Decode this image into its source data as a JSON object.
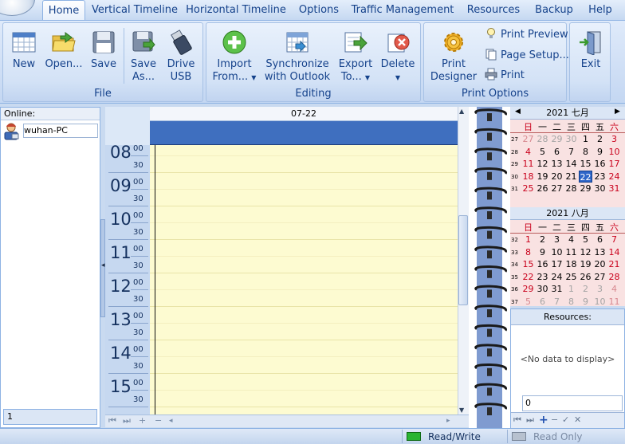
{
  "ribbon": {
    "tabs": [
      {
        "label": "Home",
        "active": true
      },
      {
        "label": "Vertical Timeline"
      },
      {
        "label": "Horizontal Timeline"
      },
      {
        "label": "Options"
      },
      {
        "label": "Traffic Management"
      },
      {
        "label": "Resources"
      },
      {
        "label": "Backup"
      },
      {
        "label": "Help"
      }
    ],
    "groups": {
      "file": {
        "label": "File",
        "buttons": {
          "new": "New",
          "open": "Open...",
          "save": "Save",
          "save_as_1": "Save",
          "save_as_2": "As...",
          "drive_usb_1": "Drive",
          "drive_usb_2": "USB"
        }
      },
      "editing": {
        "label": "Editing",
        "buttons": {
          "import_1": "Import",
          "import_2": "From...",
          "sync_1": "Synchronize",
          "sync_2": "with Outlook",
          "export_1": "Export",
          "export_2": "To...",
          "delete": "Delete"
        }
      },
      "print": {
        "label": "Print Options",
        "buttons": {
          "designer_1": "Print",
          "designer_2": "Designer",
          "preview": "Print Preview",
          "page_setup": "Page Setup...",
          "print": "Print"
        }
      },
      "exit": {
        "label": "Exit"
      }
    }
  },
  "left_panel": {
    "header": "Online:",
    "users": [
      "wuhan-PC"
    ],
    "page": "1"
  },
  "schedule": {
    "date": "07-22",
    "hours": [
      "08",
      "09",
      "10",
      "11",
      "12",
      "13",
      "14",
      "15"
    ],
    "minute_labels": [
      "00",
      "30"
    ]
  },
  "calendars": {
    "months": [
      {
        "title": "2021 七月",
        "dow": [
          "日",
          "一",
          "二",
          "三",
          "四",
          "五",
          "六"
        ],
        "weeks": [
          {
            "wk": "27",
            "days": [
              "27",
              "28",
              "29",
              "30",
              "1",
              "2",
              "3"
            ]
          },
          {
            "wk": "28",
            "days": [
              "4",
              "5",
              "6",
              "7",
              "8",
              "9",
              "10"
            ]
          },
          {
            "wk": "29",
            "days": [
              "11",
              "12",
              "13",
              "14",
              "15",
              "16",
              "17"
            ]
          },
          {
            "wk": "30",
            "days": [
              "18",
              "19",
              "20",
              "21",
              "22",
              "23",
              "24"
            ]
          },
          {
            "wk": "31",
            "days": [
              "25",
              "26",
              "27",
              "28",
              "29",
              "30",
              "31"
            ]
          }
        ],
        "dim_prefix": 4,
        "dim_suffix": 0,
        "today": "22"
      },
      {
        "title": "2021 八月",
        "dow": [
          "日",
          "一",
          "二",
          "三",
          "四",
          "五",
          "六"
        ],
        "weeks": [
          {
            "wk": "32",
            "days": [
              "1",
              "2",
              "3",
              "4",
              "5",
              "6",
              "7"
            ]
          },
          {
            "wk": "33",
            "days": [
              "8",
              "9",
              "10",
              "11",
              "12",
              "13",
              "14"
            ]
          },
          {
            "wk": "34",
            "days": [
              "15",
              "16",
              "17",
              "18",
              "19",
              "20",
              "21"
            ]
          },
          {
            "wk": "35",
            "days": [
              "22",
              "23",
              "24",
              "25",
              "26",
              "27",
              "28"
            ]
          },
          {
            "wk": "36",
            "days": [
              "29",
              "30",
              "31",
              "1",
              "2",
              "3",
              "4"
            ]
          },
          {
            "wk": "37",
            "days": [
              "5",
              "6",
              "7",
              "8",
              "9",
              "10",
              "11"
            ]
          }
        ],
        "dim_prefix": 0,
        "dim_suffix": 11
      }
    ]
  },
  "resources": {
    "header": "Resources:",
    "empty_text": "<No data to display>",
    "count": "0"
  },
  "status_bar": {
    "read_write": "Read/Write",
    "read_only": "Read Only"
  },
  "colors": {
    "ribbon_bg": "#c4d7f2",
    "schedule_slot": "#fdfbd1",
    "allday_bar": "#3f6fbf",
    "today": "#2f66c8",
    "weekend_red": "#c9001b",
    "calendar_bg": "#f9e2e2"
  }
}
